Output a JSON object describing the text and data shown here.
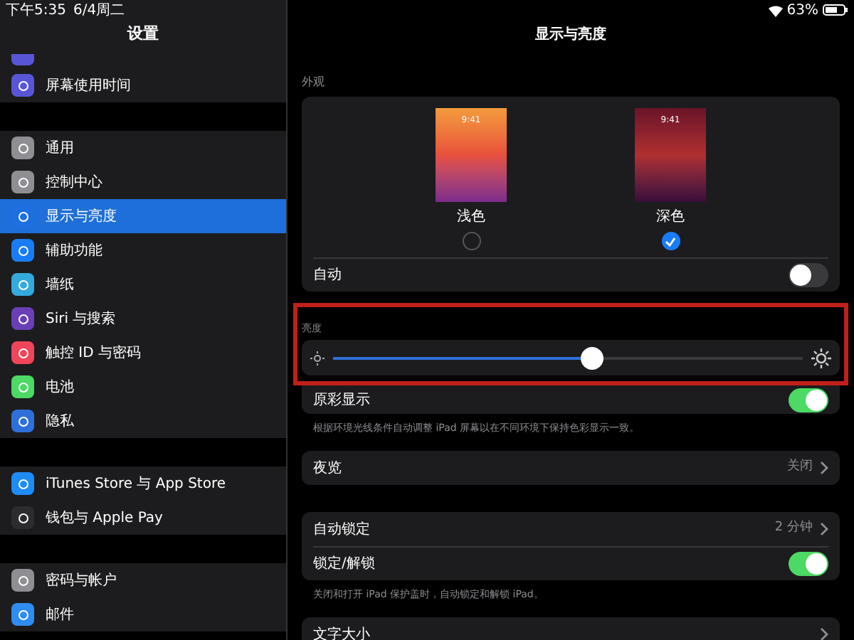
{
  "status_bar": {
    "time": "下午5:35",
    "date": "6/4周二",
    "battery": "63%"
  },
  "sidebar": {
    "title": "设置",
    "partial_item": {
      "color": "#5856d6"
    },
    "groups": [
      [
        {
          "label": "屏幕使用时间",
          "color": "#5856d6",
          "selected": false
        }
      ],
      [
        {
          "label": "通用",
          "color": "#8e8e93",
          "selected": false
        },
        {
          "label": "控制中心",
          "color": "#8e8e93",
          "selected": false
        },
        {
          "label": "显示与亮度",
          "color": "#1e6fe0",
          "selected": true
        },
        {
          "label": "辅助功能",
          "color": "#1a7cf5",
          "selected": false
        },
        {
          "label": "墙纸",
          "color": "#34aadc",
          "selected": false
        },
        {
          "label": "Siri 与搜索",
          "color": "#6a3fb5",
          "selected": false
        },
        {
          "label": "触控 ID 与密码",
          "color": "#f0455a",
          "selected": false
        },
        {
          "label": "电池",
          "color": "#4cd964",
          "selected": false
        },
        {
          "label": "隐私",
          "color": "#2f6fdb",
          "selected": false
        }
      ],
      [
        {
          "label": "iTunes Store 与 App Store",
          "color": "#1d8cf5",
          "selected": false
        },
        {
          "label": "钱包与 Apple Pay",
          "color": "#2c2c2e",
          "selected": false
        }
      ],
      [
        {
          "label": "密码与帐户",
          "color": "#8e8e93",
          "selected": false
        },
        {
          "label": "邮件",
          "color": "#2f8cf0",
          "selected": false
        }
      ]
    ]
  },
  "main": {
    "title": "显示与亮度",
    "appearance": {
      "label": "外观",
      "options": [
        {
          "label": "浅色",
          "kind": "light",
          "time": "9:41",
          "selected": false
        },
        {
          "label": "深色",
          "kind": "dark",
          "time": "9:41",
          "selected": true
        }
      ],
      "auto": {
        "label": "自动",
        "on": false
      }
    },
    "brightness": {
      "label": "亮度",
      "level": 0.55
    },
    "true_tone": {
      "label": "原彩显示",
      "on": true,
      "note": "根据环境光线条件自动调整 iPad 屏幕以在不同环境下保持色彩显示一致。"
    },
    "night_shift": {
      "label": "夜览",
      "value": "关闭"
    },
    "lock": {
      "rows": [
        {
          "kind": "link",
          "label": "自动锁定",
          "value": "2 分钟"
        },
        {
          "kind": "toggle",
          "label": "锁定/解锁",
          "on": true
        }
      ],
      "note": "关闭和打开 iPad 保护盖时，自动锁定和解锁 iPad。"
    },
    "text_size": {
      "label": "文字大小"
    }
  }
}
